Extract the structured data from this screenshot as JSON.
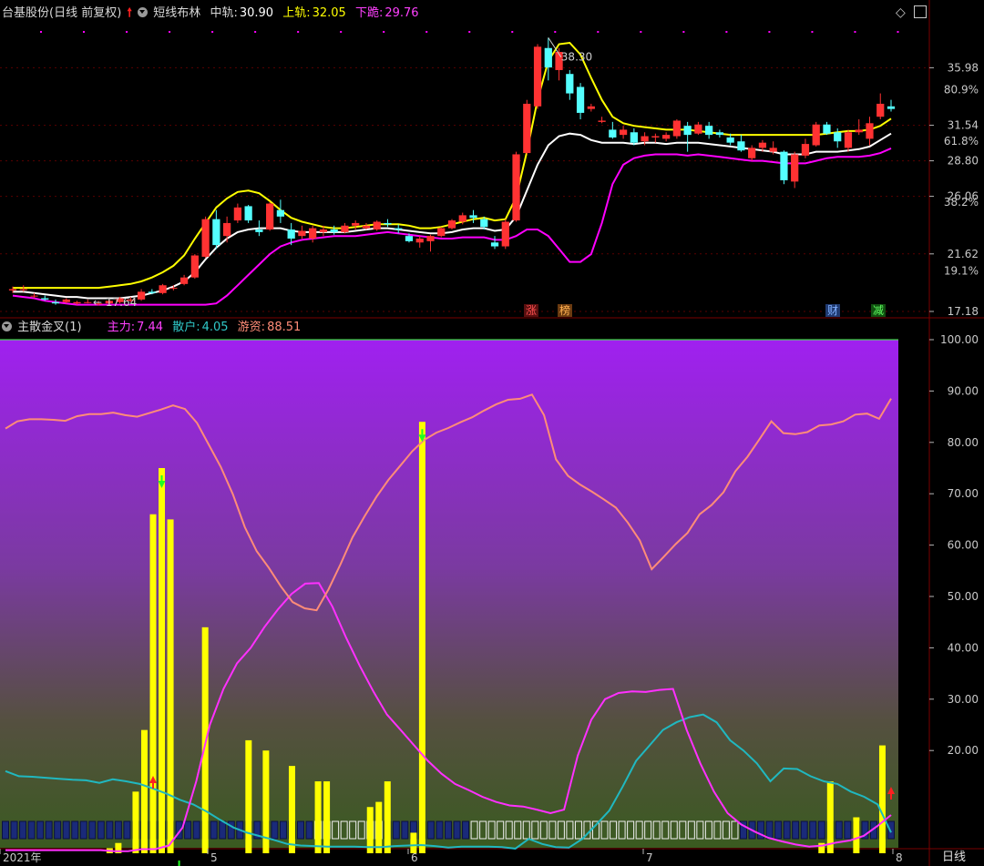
{
  "top_header": {
    "stock": "台基股份(日线 前复权)",
    "indicator": "短线布林",
    "mid_label": "中轨:",
    "mid_value": "30.90",
    "upper_label": "上轨:",
    "upper_value": "32.05",
    "lower_label": "下跪:",
    "lower_value": "29.76"
  },
  "bottom_header": {
    "indicator": "主散金叉(1)",
    "main_label": "主力:",
    "main_value": "7.44",
    "retail_label": "散户:",
    "retail_value": "4.05",
    "hot_label": "游资:",
    "hot_value": "88.51"
  },
  "tags": {
    "zhang": "涨",
    "bang": "榜",
    "cai": "财",
    "jian": "减"
  },
  "period_button": "日线",
  "annotations": {
    "high": "38.30",
    "low": "← 17.64"
  },
  "colors": {
    "up": "#ff3232",
    "down": "#54ffff",
    "upper": "#ffff00",
    "mid": "#ffffff",
    "lower": "#ff00ff",
    "hot": "#ff8c78",
    "main": "#ff30ff",
    "retail": "#20b8c0",
    "bar": "#ffff00",
    "axis": "#b4b4b4"
  },
  "chart_data": [
    {
      "type": "candlestick",
      "title": "台基股份(日线 前复权) 短线布林",
      "y_ticks": [
        "35.98",
        "31.54",
        "28.80",
        "26.06",
        "21.62",
        "17.18"
      ],
      "y_percent_ticks": [
        "80.9%",
        "61.8%",
        "38.2%",
        "19.1%"
      ],
      "high_label": "38.30",
      "low_label": "17.64",
      "candles": [
        [
          18.8,
          19.1,
          18.6,
          18.9
        ],
        [
          18.9,
          19.2,
          18.7,
          18.9
        ],
        [
          18.4,
          18.6,
          18.2,
          18.4
        ],
        [
          18.2,
          18.4,
          18.0,
          18.1
        ],
        [
          17.9,
          18.1,
          17.7,
          17.8
        ],
        [
          17.9,
          18.2,
          17.8,
          18.1
        ],
        [
          17.8,
          18.0,
          17.7,
          17.9
        ],
        [
          17.9,
          18.1,
          17.8,
          17.9
        ],
        [
          17.8,
          18.0,
          17.64,
          17.8
        ],
        [
          17.8,
          18.1,
          17.7,
          18.0
        ],
        [
          17.9,
          18.3,
          17.8,
          18.2
        ],
        [
          18.0,
          18.3,
          17.9,
          18.1
        ],
        [
          18.1,
          18.9,
          18.0,
          18.7
        ],
        [
          18.7,
          18.9,
          18.5,
          18.6
        ],
        [
          18.6,
          19.3,
          18.5,
          19.2
        ],
        [
          19.0,
          19.2,
          18.8,
          19.0
        ],
        [
          19.3,
          20.0,
          19.2,
          19.8
        ],
        [
          19.8,
          21.6,
          19.7,
          21.5
        ],
        [
          21.4,
          24.5,
          21.3,
          24.3
        ],
        [
          24.3,
          25.0,
          22.0,
          22.3
        ],
        [
          23.0,
          24.5,
          22.5,
          24.0
        ],
        [
          24.2,
          25.5,
          24.0,
          25.2
        ],
        [
          25.3,
          25.4,
          24.0,
          24.2
        ],
        [
          23.5,
          24.2,
          23.0,
          23.3
        ],
        [
          23.5,
          25.6,
          23.4,
          25.5
        ],
        [
          25.0,
          25.8,
          24.0,
          24.5
        ],
        [
          23.5,
          24.0,
          22.3,
          22.8
        ],
        [
          23.0,
          23.8,
          22.8,
          23.4
        ],
        [
          22.8,
          23.8,
          22.5,
          23.6
        ],
        [
          23.3,
          23.8,
          23.0,
          23.5
        ],
        [
          23.5,
          23.8,
          23.1,
          23.3
        ],
        [
          23.3,
          24.0,
          23.2,
          23.8
        ],
        [
          23.8,
          24.2,
          23.5,
          24.0
        ],
        [
          23.6,
          24.0,
          23.5,
          23.8
        ],
        [
          23.5,
          24.2,
          23.4,
          24.1
        ],
        [
          24.0,
          24.3,
          23.7,
          23.9
        ],
        [
          23.6,
          23.9,
          23.2,
          23.5
        ],
        [
          23.0,
          23.2,
          22.5,
          22.6
        ],
        [
          22.5,
          23.0,
          22.1,
          22.8
        ],
        [
          22.6,
          23.1,
          21.8,
          23.0
        ],
        [
          23.0,
          23.7,
          22.9,
          23.6
        ],
        [
          23.6,
          24.3,
          23.5,
          24.2
        ],
        [
          24.1,
          24.8,
          23.9,
          24.6
        ],
        [
          24.6,
          25.0,
          24.0,
          24.4
        ],
        [
          24.3,
          24.5,
          23.5,
          23.7
        ],
        [
          22.5,
          23.0,
          22.0,
          22.2
        ],
        [
          22.2,
          24.3,
          22.0,
          24.1
        ],
        [
          24.2,
          29.5,
          24.1,
          29.3
        ],
        [
          29.4,
          33.5,
          29.3,
          33.2
        ],
        [
          33.0,
          37.8,
          32.8,
          37.6
        ],
        [
          37.5,
          38.3,
          35.0,
          36.0
        ],
        [
          35.8,
          37.5,
          35.0,
          37.2
        ],
        [
          35.5,
          35.8,
          33.5,
          34.0
        ],
        [
          34.5,
          34.8,
          32.0,
          32.5
        ],
        [
          32.8,
          33.2,
          32.6,
          33.0
        ],
        [
          31.8,
          32.2,
          31.7,
          31.9
        ],
        [
          31.2,
          31.8,
          30.5,
          30.6
        ],
        [
          30.8,
          31.5,
          30.5,
          31.2
        ],
        [
          31.0,
          31.3,
          30.0,
          30.2
        ],
        [
          30.3,
          31.0,
          30.0,
          30.7
        ],
        [
          30.6,
          30.9,
          30.2,
          30.7
        ],
        [
          30.5,
          31.0,
          30.3,
          30.8
        ],
        [
          30.7,
          32.0,
          30.5,
          31.9
        ],
        [
          31.5,
          31.8,
          29.5,
          30.8
        ],
        [
          30.9,
          31.8,
          30.8,
          31.6
        ],
        [
          31.5,
          31.8,
          30.5,
          30.8
        ],
        [
          31.0,
          31.2,
          30.6,
          30.8
        ],
        [
          30.6,
          30.9,
          30.0,
          30.2
        ],
        [
          30.3,
          30.8,
          29.5,
          29.6
        ],
        [
          29.0,
          30.0,
          28.8,
          29.8
        ],
        [
          29.8,
          30.4,
          29.5,
          30.2
        ],
        [
          29.5,
          30.3,
          29.3,
          29.8
        ],
        [
          29.5,
          29.6,
          27.0,
          27.3
        ],
        [
          27.2,
          29.5,
          26.7,
          29.3
        ],
        [
          29.2,
          30.5,
          29.0,
          30.1
        ],
        [
          30.0,
          31.8,
          29.9,
          31.6
        ],
        [
          31.6,
          31.8,
          30.8,
          30.9
        ],
        [
          31.0,
          31.3,
          29.8,
          30.3
        ],
        [
          29.8,
          31.2,
          29.5,
          31.0
        ],
        [
          31.0,
          32.0,
          30.8,
          31.2
        ],
        [
          30.5,
          32.2,
          30.0,
          31.7
        ],
        [
          32.2,
          34.0,
          32.0,
          33.2
        ],
        [
          33.0,
          33.5,
          32.6,
          32.8
        ]
      ],
      "upper": [
        19.0,
        19.0,
        19.0,
        19.0,
        19.0,
        19.0,
        19.0,
        19.0,
        19.0,
        19.1,
        19.2,
        19.3,
        19.5,
        19.8,
        20.2,
        20.7,
        21.5,
        22.8,
        24.0,
        25.2,
        25.9,
        26.4,
        26.5,
        26.3,
        25.7,
        25.0,
        24.4,
        24.1,
        23.9,
        23.7,
        23.6,
        23.6,
        23.7,
        23.8,
        23.9,
        23.9,
        23.9,
        23.8,
        23.6,
        23.6,
        23.7,
        23.9,
        24.1,
        24.3,
        24.4,
        24.2,
        24.3,
        26.0,
        29.5,
        33.5,
        36.5,
        37.8,
        37.9,
        37.0,
        35.2,
        33.5,
        32.2,
        31.7,
        31.5,
        31.4,
        31.3,
        31.2,
        31.2,
        31.2,
        31.1,
        31.0,
        30.9,
        30.8,
        30.8,
        30.8,
        30.8,
        30.8,
        30.8,
        30.8,
        30.8,
        30.8,
        30.9,
        31.0,
        31.1,
        31.1,
        31.2,
        31.5,
        32.05
      ],
      "mid": [
        18.7,
        18.7,
        18.6,
        18.5,
        18.4,
        18.3,
        18.3,
        18.2,
        18.2,
        18.2,
        18.2,
        18.3,
        18.4,
        18.6,
        18.8,
        19.1,
        19.5,
        20.2,
        21.2,
        22.1,
        22.8,
        23.3,
        23.5,
        23.6,
        23.6,
        23.6,
        23.4,
        23.3,
        23.3,
        23.3,
        23.3,
        23.3,
        23.4,
        23.5,
        23.6,
        23.6,
        23.5,
        23.4,
        23.3,
        23.2,
        23.2,
        23.3,
        23.5,
        23.6,
        23.6,
        23.4,
        23.5,
        24.5,
        26.5,
        28.5,
        30.0,
        30.7,
        30.9,
        30.8,
        30.4,
        30.2,
        30.2,
        30.2,
        30.1,
        30.2,
        30.2,
        30.1,
        30.2,
        30.2,
        30.2,
        30.1,
        30.0,
        29.9,
        29.8,
        29.7,
        29.6,
        29.5,
        29.3,
        29.3,
        29.3,
        29.5,
        29.5,
        29.5,
        29.6,
        29.7,
        29.9,
        30.4,
        30.9
      ],
      "lower": [
        18.4,
        18.3,
        18.2,
        18.0,
        17.9,
        17.8,
        17.7,
        17.7,
        17.7,
        17.7,
        17.7,
        17.7,
        17.7,
        17.7,
        17.7,
        17.7,
        17.7,
        17.7,
        17.7,
        17.8,
        18.4,
        19.2,
        20.0,
        20.8,
        21.6,
        22.2,
        22.5,
        22.7,
        22.8,
        22.9,
        23.0,
        23.0,
        23.0,
        23.1,
        23.2,
        23.3,
        23.2,
        23.1,
        23.0,
        22.9,
        22.8,
        22.8,
        22.9,
        22.9,
        22.9,
        22.7,
        22.7,
        23.0,
        23.5,
        23.5,
        23.0,
        22.0,
        21.0,
        21.0,
        21.6,
        24.0,
        27.0,
        28.5,
        29.0,
        29.2,
        29.3,
        29.3,
        29.3,
        29.2,
        29.3,
        29.2,
        29.1,
        29.0,
        28.9,
        28.8,
        28.8,
        28.7,
        28.6,
        28.6,
        28.6,
        28.8,
        29.0,
        29.1,
        29.1,
        29.1,
        29.2,
        29.4,
        29.76
      ]
    },
    {
      "type": "bar+line",
      "title": "主散金叉(1)",
      "x_tick_labels": [
        "2021年",
        "5",
        "6",
        "7",
        "8"
      ],
      "y_ticks": [
        100,
        90,
        80,
        70,
        60,
        50,
        40,
        30,
        20
      ],
      "ylim": [
        0,
        100
      ],
      "bars": [
        0,
        0,
        0,
        0,
        0,
        0,
        0,
        0,
        0,
        0,
        0,
        0,
        1,
        2,
        0,
        12,
        24,
        66,
        75,
        65,
        0,
        0,
        0,
        44,
        0,
        0,
        0,
        0,
        22,
        0,
        20,
        0,
        0,
        17,
        0,
        0,
        14,
        14,
        0,
        0,
        0,
        0,
        9,
        10,
        14,
        0,
        0,
        4,
        84,
        0,
        0,
        0,
        0,
        0,
        0,
        0,
        0,
        0,
        0,
        0,
        0,
        0,
        0,
        0,
        0,
        0,
        0,
        0,
        0,
        0,
        0,
        0,
        0,
        0,
        0,
        0,
        0,
        0,
        0,
        0,
        0,
        0,
        0,
        0,
        0,
        0,
        0,
        0,
        0,
        0,
        0,
        0,
        0,
        0,
        2,
        14,
        0,
        0,
        7,
        0,
        0,
        21,
        0
      ],
      "hot": [
        82.7,
        84.1,
        84.5,
        84.5,
        84.4,
        84.2,
        85.1,
        85.5,
        85.5,
        85.8,
        85.3,
        85.0,
        85.7,
        86.4,
        87.2,
        86.5,
        83.8,
        79.5,
        75.2,
        69.9,
        63.5,
        58.8,
        55.6,
        52.0,
        48.9,
        47.7,
        47.3,
        51.4,
        56.3,
        61.5,
        65.6,
        69.4,
        72.7,
        75.5,
        78.3,
        80.5,
        81.9,
        82.8,
        83.9,
        84.9,
        86.2,
        87.4,
        88.3,
        88.5,
        89.3,
        85.3,
        76.7,
        73.5,
        71.8,
        70.4,
        68.9,
        67.3,
        64.4,
        60.9,
        55.3,
        57.7,
        60.2,
        62.4,
        66.0,
        67.8,
        70.3,
        74.4,
        77.2,
        80.6,
        84.1,
        81.8,
        81.6,
        82.0,
        83.3,
        83.5,
        84.1,
        85.4,
        85.6,
        84.6,
        88.51
      ],
      "main": [
        0.6,
        0.6,
        0.6,
        0.6,
        0.6,
        0.6,
        0.6,
        0.6,
        0.4,
        0.4,
        0.8,
        0.8,
        1.5,
        5.0,
        14.0,
        25.0,
        32.0,
        37.0,
        40.0,
        44.0,
        47.5,
        50.5,
        52.5,
        52.6,
        48.0,
        42.0,
        36.5,
        31.5,
        27.0,
        24.0,
        21.0,
        18.0,
        15.5,
        13.5,
        12.3,
        11.0,
        10.0,
        9.3,
        9.1,
        8.5,
        7.8,
        8.5,
        19.0,
        26.0,
        30.0,
        31.2,
        31.5,
        31.4,
        31.8,
        32.0,
        24.0,
        17.5,
        12.0,
        7.8,
        5.6,
        4.2,
        3.0,
        2.3,
        1.7,
        1.3,
        1.5,
        2.1,
        2.5,
        3.4,
        5.3,
        7.44
      ],
      "retail": [
        16.0,
        15.0,
        14.9,
        14.7,
        14.5,
        14.3,
        14.2,
        13.7,
        14.4,
        14.0,
        13.5,
        12.6,
        11.6,
        10.4,
        9.5,
        8.1,
        6.5,
        5.0,
        4.0,
        3.3,
        2.6,
        1.8,
        1.5,
        1.4,
        1.3,
        1.3,
        1.3,
        1.2,
        1.2,
        1.4,
        1.5,
        1.6,
        1.4,
        1.1,
        1.3,
        1.3,
        1.3,
        1.2,
        0.9,
        2.8,
        1.8,
        1.2,
        1.1,
        2.8,
        5.5,
        8.3,
        13.0,
        18.0,
        21.0,
        24.0,
        25.5,
        26.5,
        27.0,
        25.5,
        22.0,
        20.0,
        17.5,
        14.0,
        16.5,
        16.4,
        15.0,
        14.0,
        13.5,
        12.0,
        11.0,
        9.5,
        4.05
      ],
      "up_arrow_bars": [
        17,
        102
      ],
      "down_arrow_bars": [
        18,
        20,
        48
      ]
    }
  ]
}
